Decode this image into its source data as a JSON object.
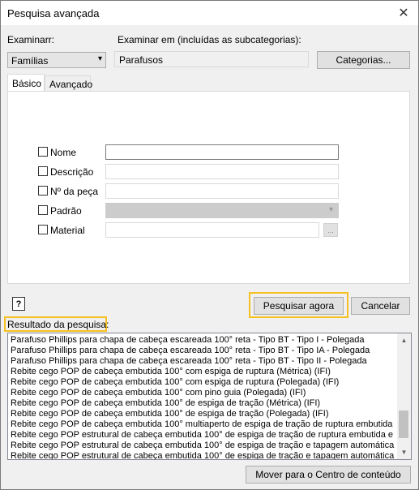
{
  "window": {
    "title": "Pesquisa avançada",
    "close_icon": "close-icon"
  },
  "examine": {
    "label": "Examinarr:",
    "selected": "Famílias"
  },
  "examine_in": {
    "label": "Examinar em (incluídas as subcategorias):",
    "value": "Parafusos"
  },
  "categories_button": "Categorias...",
  "tabs": [
    {
      "label": "Básico",
      "active": true
    },
    {
      "label": "Avançado",
      "active": false
    }
  ],
  "criteria": [
    {
      "label": "Nome",
      "checked": false,
      "value": ""
    },
    {
      "label": "Descrição",
      "checked": false,
      "value": ""
    },
    {
      "label": "Nº da peça",
      "checked": false,
      "value": ""
    },
    {
      "label": "Padrão",
      "checked": false,
      "value": ""
    },
    {
      "label": "Material",
      "checked": false,
      "value": ""
    }
  ],
  "browse_label": "...",
  "help_glyph": "?",
  "search_button": "Pesquisar agora",
  "cancel_button": "Cancelar",
  "results_label": "Resultado da pesquisa:",
  "results": [
    "Parafuso Phillips para chapa de cabeça escareada 100° reta - Tipo BT - Tipo I - Polegada",
    "Parafuso Phillips para chapa de cabeça escareada 100° reta - Tipo BT - Tipo IA - Polegada",
    "Parafuso Phillips para chapa de cabeça escareada 100° reta - Tipo BT - Tipo II - Polegada",
    "Rebite cego POP de cabeça embutida 100° com espiga de ruptura (Métrica) (IFI)",
    "Rebite cego POP de cabeça embutida 100° com espiga de ruptura (Polegada) (IFI)",
    "Rebite cego POP de cabeça embutida 100° com pino guia (Polegada) (IFI)",
    "Rebite cego POP de cabeça embutida 100° de espiga de tração (Métrica) (IFI)",
    "Rebite cego POP de cabeça embutida 100° de espiga de tração (Polegada) (IFI)",
    "Rebite cego POP de cabeça embutida 100° multiaperto de espiga de tração de ruptura embutida e t",
    "Rebite cego POP estrutural de cabeça embutida 100° de espiga de tração de ruptura embutida e tap",
    "Rebite cego POP estrutural de cabeça embutida 100° de espiga de tração e tapagem automática (Po",
    "Rebite cego POP estrutural de cabeça embutida 100° de espiga de tração e tapagem automática (Po"
  ],
  "move_button": "Mover para o Centro de conteúdo",
  "highlight_color": "#f5c022"
}
